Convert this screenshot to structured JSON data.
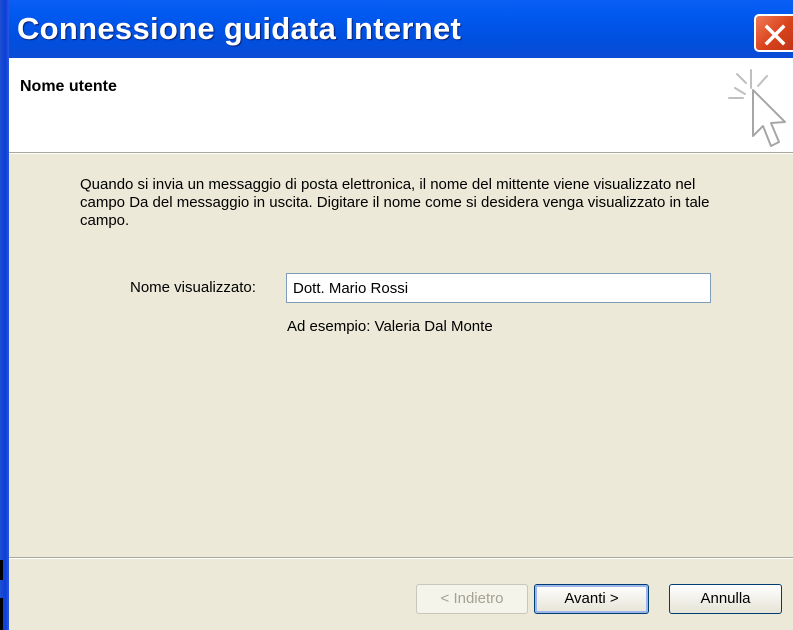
{
  "window": {
    "title": "Connessione guidata Internet",
    "close_icon": "close-icon"
  },
  "header": {
    "title": "Nome utente",
    "icon": "wizard-cursor-icon"
  },
  "body": {
    "description": "Quando si invia un messaggio di posta elettronica, il nome del mittente viene visualizzato nel campo Da del messaggio in uscita. Digitare il nome come si desidera venga visualizzato in tale campo.",
    "display_name_label": "Nome visualizzato:",
    "display_name_value": "Dott. Mario Rossi",
    "example": "Ad esempio: Valeria Dal Monte"
  },
  "buttons": {
    "back": "< Indietro",
    "next": "Avanti >",
    "cancel": "Annulla"
  },
  "colors": {
    "titlebar": "#0054E3",
    "dialog_bg": "#ECE9D8",
    "close": "#D9431B"
  }
}
